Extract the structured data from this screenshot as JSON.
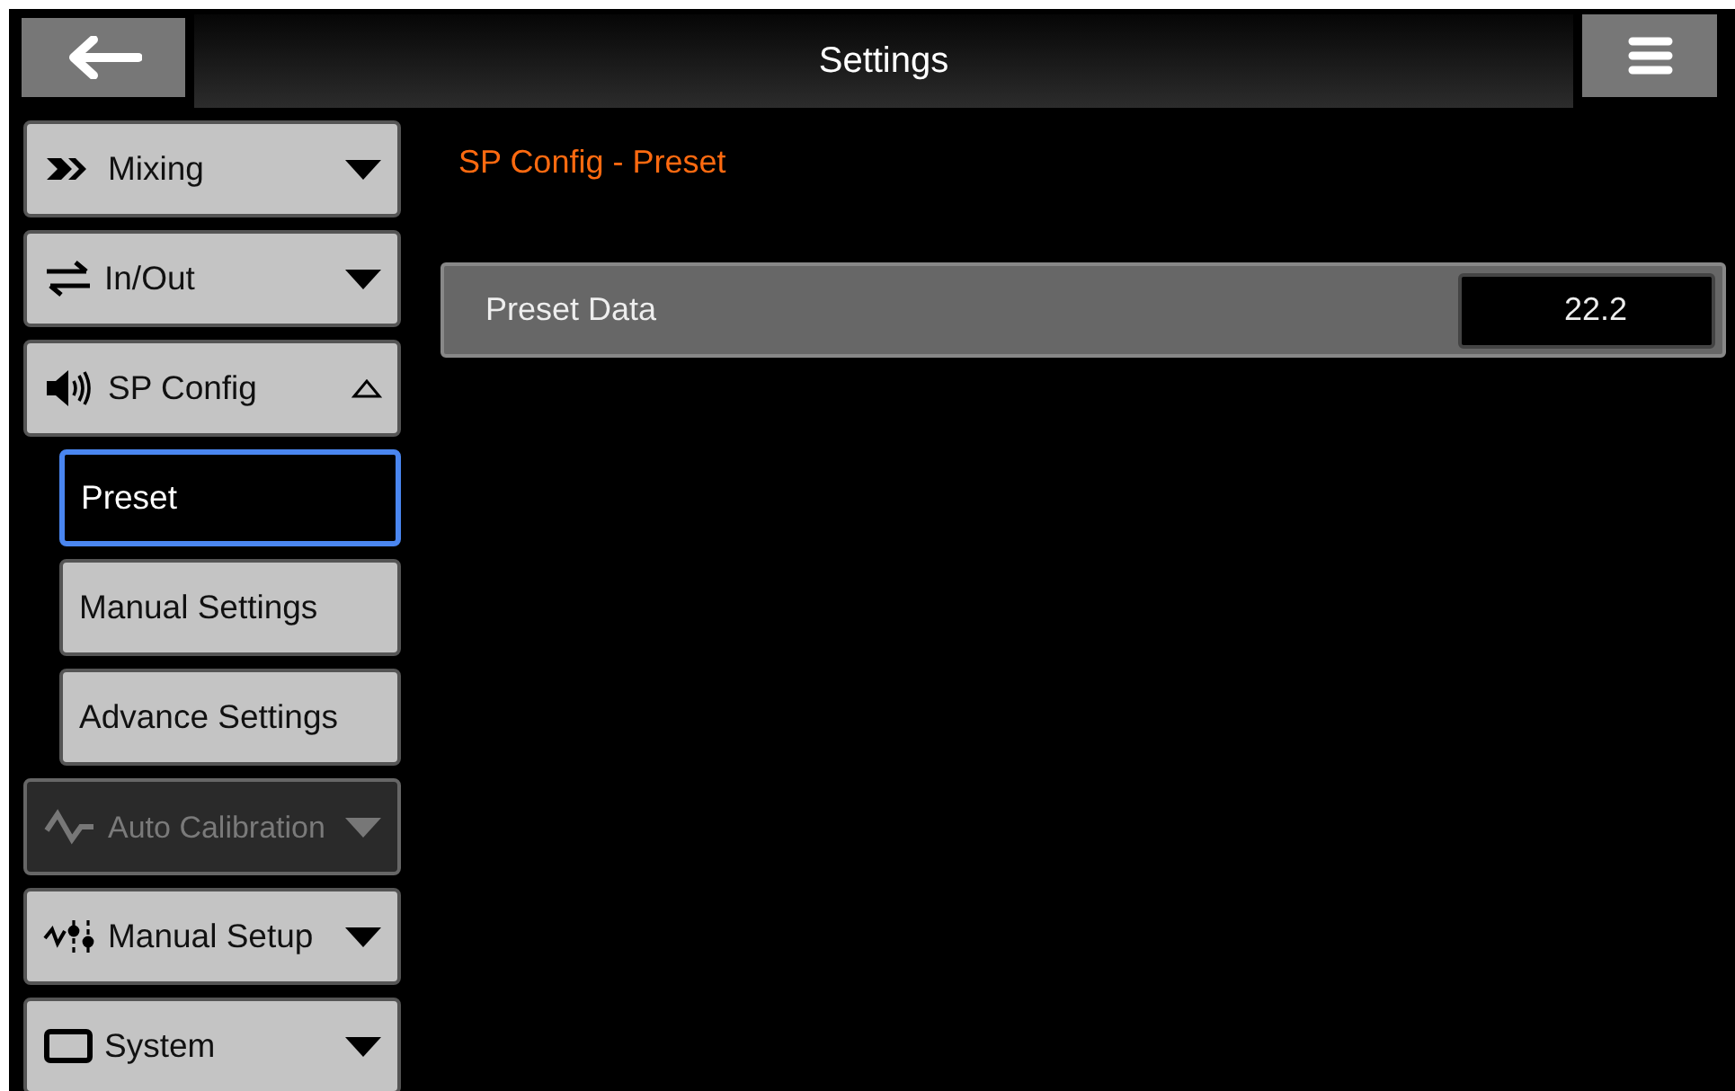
{
  "header": {
    "title": "Settings"
  },
  "sidebar": {
    "items": [
      {
        "kind": "category",
        "label": "Mixing",
        "expanded": false,
        "disabled": false
      },
      {
        "kind": "category",
        "label": "In/Out",
        "expanded": false,
        "disabled": false
      },
      {
        "kind": "category",
        "label": "SP Config",
        "expanded": true,
        "disabled": false
      },
      {
        "kind": "sub",
        "label": "Preset",
        "selected": true
      },
      {
        "kind": "sub",
        "label": "Manual Settings",
        "selected": false
      },
      {
        "kind": "sub",
        "label": "Advance Settings",
        "selected": false
      },
      {
        "kind": "category",
        "label": "Auto Calibration",
        "expanded": false,
        "disabled": true
      },
      {
        "kind": "category",
        "label": "Manual Setup",
        "expanded": false,
        "disabled": false
      },
      {
        "kind": "category",
        "label": "System",
        "expanded": false,
        "disabled": false
      }
    ]
  },
  "content": {
    "title": "SP Config - Preset",
    "rows": [
      {
        "label": "Preset Data",
        "value": "22.2"
      }
    ]
  }
}
